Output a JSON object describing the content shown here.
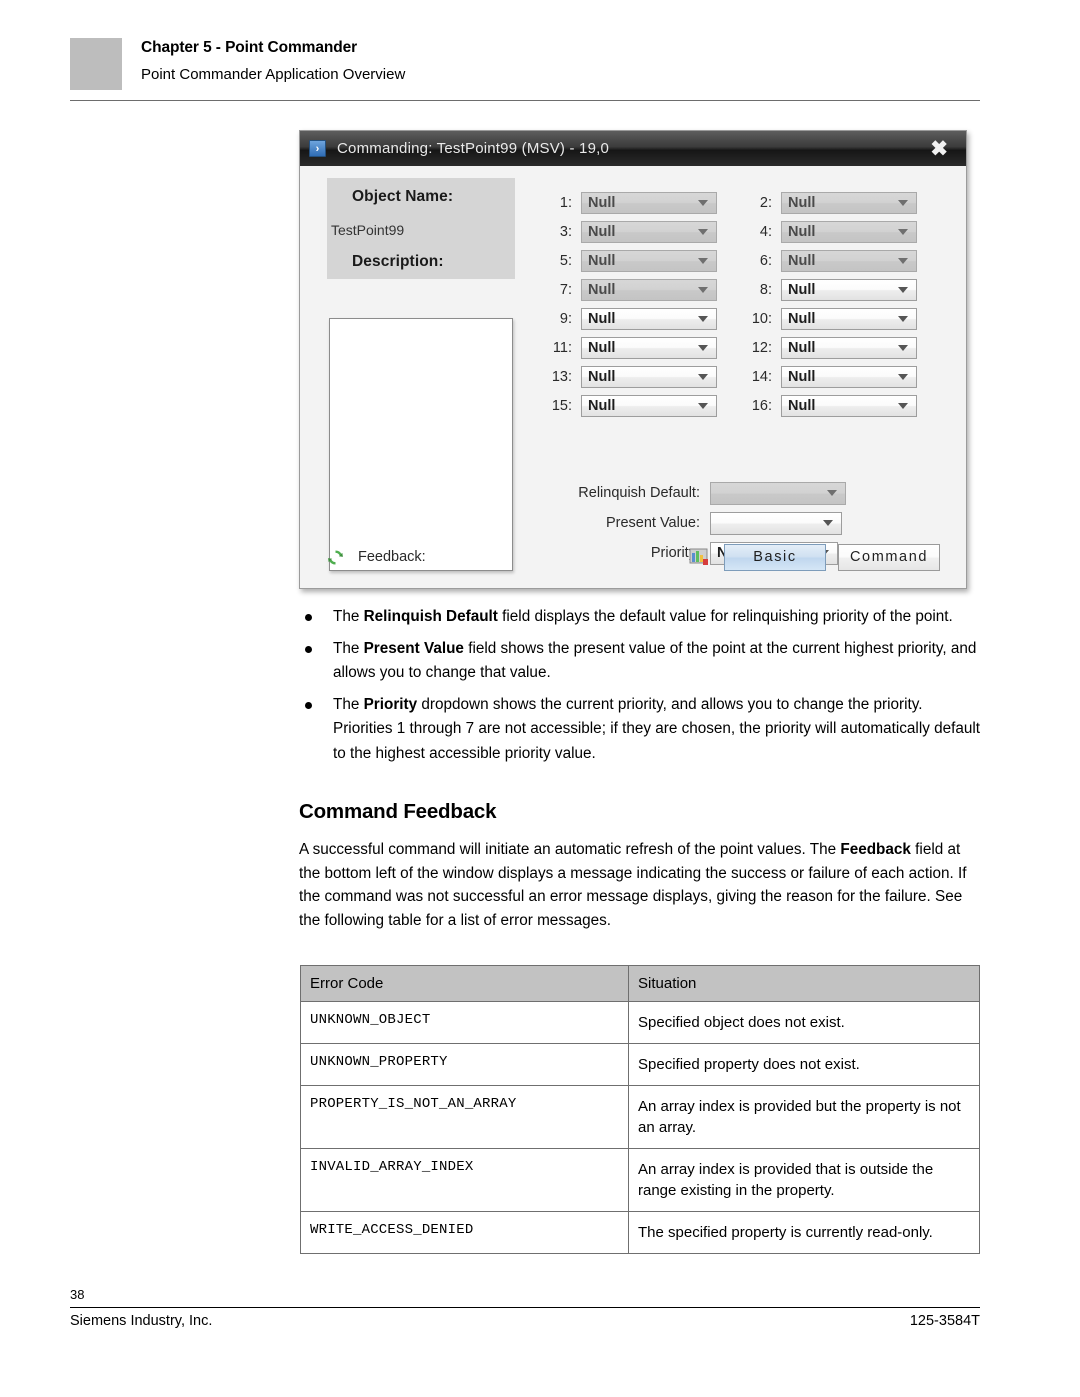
{
  "page_header": {
    "chapter": "Chapter 5 - Point Commander",
    "subtitle": "Point Commander Application Overview"
  },
  "dialog": {
    "title": "Commanding: TestPoint99 (MSV) - 19,0",
    "titlebar_icon": "chevron-right-icon",
    "close_label": "✖",
    "info_panel": {
      "object_name_label": "Object Name:",
      "object_name_value": "TestPoint99",
      "description_label": "Description:",
      "description_value": ""
    },
    "priority_array": [
      {
        "index": "1:",
        "value": "Null",
        "enabled": false
      },
      {
        "index": "2:",
        "value": "Null",
        "enabled": false
      },
      {
        "index": "3:",
        "value": "Null",
        "enabled": false
      },
      {
        "index": "4:",
        "value": "Null",
        "enabled": false
      },
      {
        "index": "5:",
        "value": "Null",
        "enabled": false
      },
      {
        "index": "6:",
        "value": "Null",
        "enabled": false
      },
      {
        "index": "7:",
        "value": "Null",
        "enabled": false
      },
      {
        "index": "8:",
        "value": "Null",
        "enabled": true
      },
      {
        "index": "9:",
        "value": "Null",
        "enabled": true
      },
      {
        "index": "10:",
        "value": "Null",
        "enabled": true
      },
      {
        "index": "11:",
        "value": "Null",
        "enabled": true
      },
      {
        "index": "12:",
        "value": "Null",
        "enabled": true
      },
      {
        "index": "13:",
        "value": "Null",
        "enabled": true
      },
      {
        "index": "14:",
        "value": "Null",
        "enabled": true
      },
      {
        "index": "15:",
        "value": "Null",
        "enabled": true
      },
      {
        "index": "16:",
        "value": "Null",
        "enabled": true
      }
    ],
    "fields": {
      "relinquish_default_label": "Relinquish Default:",
      "relinquish_default_value": "",
      "present_value_label": "Present Value:",
      "present_value_value": "",
      "priority_label": "Priority:",
      "priority_value": "None"
    },
    "bottom": {
      "refresh_icon": "refresh-icon",
      "feedback_label": "Feedback:",
      "feedback_value": "",
      "chart_icon": "bar-chart-icon",
      "basic_button": "Basic",
      "command_button": "Command"
    },
    "colors": {
      "titlebar": "#2b2b2b",
      "panel_gray": "#d5d5d5",
      "disabled_combo": "#cdcdcd",
      "active_button": "#cfe0f1",
      "refresh_green": "#3f9b3f",
      "icon_blue": "#2f6cb5"
    }
  },
  "bullets": [
    {
      "pre": "The ",
      "bold": "Relinquish Default",
      "post": " field displays the default value for relinquishing priority of the point."
    },
    {
      "pre": "The ",
      "bold": "Present Value",
      "post": " field shows the present value of the point at the current highest priority, and allows you to change that value."
    },
    {
      "pre": "The ",
      "bold": "Priority",
      "post": " dropdown shows the current priority, and allows you to change the priority. Priorities 1 through 7 are not accessible; if they are chosen, the priority will automatically default to the highest accessible priority value."
    }
  ],
  "section": {
    "title": "Command Feedback",
    "para_pre": "A successful command will initiate an automatic refresh of the point values. The ",
    "para_bold": "Feedback",
    "para_post": " field at the bottom left of the window displays a message indicating the success or failure of each action. If the command was not successful an error message displays, giving the reason for the failure. See the following table for a list of error messages."
  },
  "error_table": {
    "headers": [
      "Error Code",
      "Situation"
    ],
    "rows": [
      {
        "code": "UNKNOWN_OBJECT",
        "situation": "Specified object does not exist."
      },
      {
        "code": "UNKNOWN_PROPERTY",
        "situation": "Specified property does not exist."
      },
      {
        "code": "PROPERTY_IS_NOT_AN_ARRAY",
        "situation": "An array index is provided but the property is not an array."
      },
      {
        "code": "INVALID_ARRAY_INDEX",
        "situation": "An array index is provided that is outside the range existing in the property."
      },
      {
        "code": "WRITE_ACCESS_DENIED",
        "situation": "The specified property is currently read-only."
      }
    ]
  },
  "footer": {
    "page_number": "38",
    "left": "Siemens Industry, Inc.",
    "right": "125-3584T"
  }
}
